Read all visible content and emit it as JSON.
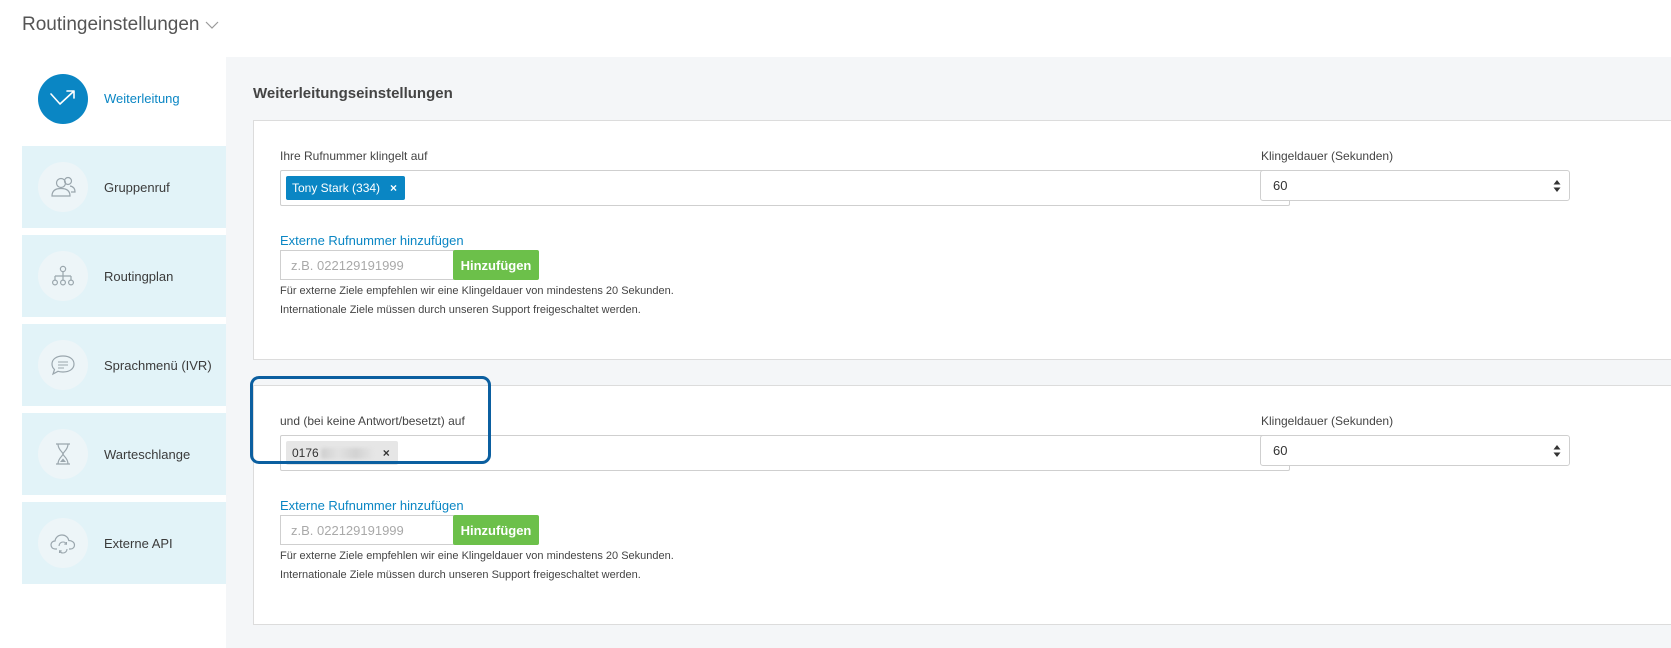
{
  "header": {
    "title": "Routingeinstellungen"
  },
  "sidebar": {
    "items": [
      {
        "label": "Weiterleitung",
        "icon": "forward-arrow-icon",
        "active": true
      },
      {
        "label": "Gruppenruf",
        "icon": "group-icon",
        "active": false
      },
      {
        "label": "Routingplan",
        "icon": "routing-plan-icon",
        "active": false
      },
      {
        "label": "Sprachmenü (IVR)",
        "icon": "speech-bubble-icon",
        "active": false
      },
      {
        "label": "Warteschlange",
        "icon": "hourglass-icon",
        "active": false
      },
      {
        "label": "Externe API",
        "icon": "cloud-sync-icon",
        "active": false
      }
    ]
  },
  "main": {
    "section_title": "Weiterleitungseinstellungen",
    "panels": [
      {
        "target_label": "Ihre Rufnummer klingelt auf",
        "tag": {
          "text": "Tony Stark (334)",
          "remove": "×"
        },
        "ring_label": "Klingeldauer (Sekunden)",
        "ring_value": "60",
        "external_label": "Externe Rufnummer hinzufügen",
        "external_placeholder": "z.B. 022129191999",
        "add_button": "Hinzufügen",
        "hint_1": "Für externe Ziele empfehlen wir eine Klingeldauer von mindestens 20 Sekunden.",
        "hint_2": "Internationale Ziele müssen durch unseren Support freigeschaltet werden."
      },
      {
        "target_label": "und (bei keine Antwort/besetzt) auf",
        "tag": {
          "text": "0176",
          "remove": "×"
        },
        "ring_label": "Klingeldauer (Sekunden)",
        "ring_value": "60",
        "external_label": "Externe Rufnummer hinzufügen",
        "external_placeholder": "z.B. 022129191999",
        "add_button": "Hinzufügen",
        "hint_1": "Für externe Ziele empfehlen wir eine Klingeldauer von mindestens 20 Sekunden.",
        "hint_2": "Internationale Ziele müssen durch unseren Support freigeschaltet werden."
      }
    ]
  },
  "colors": {
    "accent": "#0a86c4",
    "add_button": "#6cc04a",
    "sidebar_bg": "#e2f3f8",
    "highlight": "#0b5fa0"
  }
}
